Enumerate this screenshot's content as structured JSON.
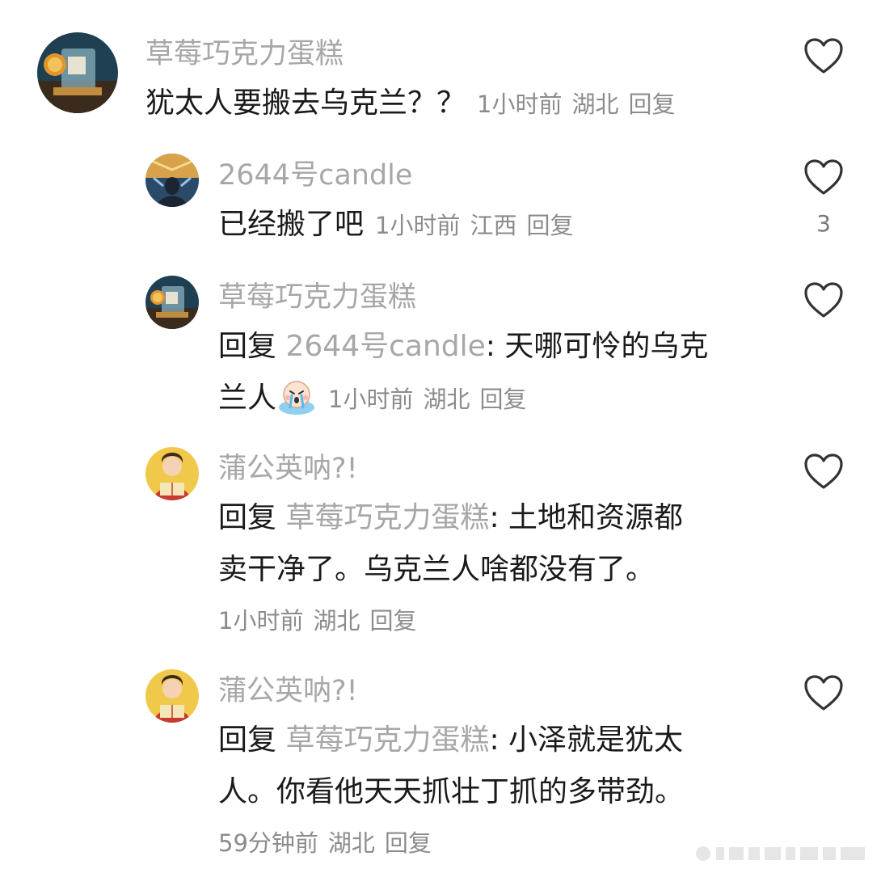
{
  "comments": [
    {
      "username": "草莓巧克力蛋糕",
      "text": "犹太人要搬去乌克兰？？",
      "time": "1小时前",
      "location": "湖北",
      "reply_label": "回复"
    },
    {
      "username": "2644号candle",
      "text": "已经搬了吧",
      "time": "1小时前",
      "location": "江西",
      "reply_label": "回复",
      "likes": "3"
    },
    {
      "username": "草莓巧克力蛋糕",
      "reply_prefix": "回复",
      "reply_to": "2644号candle",
      "text_line1": ": 天哪可怜的乌克",
      "text_line2": "兰人",
      "time": "1小时前",
      "location": "湖北",
      "reply_label": "回复"
    },
    {
      "username": "蒲公英呐?!",
      "reply_prefix": "回复",
      "reply_to": "草莓巧克力蛋糕",
      "text_line1": ": 土地和资源都",
      "text_line2": "卖干净了。乌克兰人啥都没有了。",
      "time": "1小时前",
      "location": "湖北",
      "reply_label": "回复"
    },
    {
      "username": "蒲公英呐?!",
      "reply_prefix": "回复",
      "reply_to": "草莓巧克力蛋糕",
      "text_line1": ": 小泽就是犹太",
      "text_line2": "人。你看他天天抓壮丁抓的多带劲。",
      "time": "59分钟前",
      "location": "湖北",
      "reply_label": "回复"
    }
  ],
  "icons": {
    "like": "heart-outline-icon",
    "sticker": "crying-emoji-icon"
  },
  "colors": {
    "username": "#a7a7a7",
    "text": "#1a1a1a",
    "meta": "#8c8c8c",
    "icon_stroke": "#333333"
  }
}
